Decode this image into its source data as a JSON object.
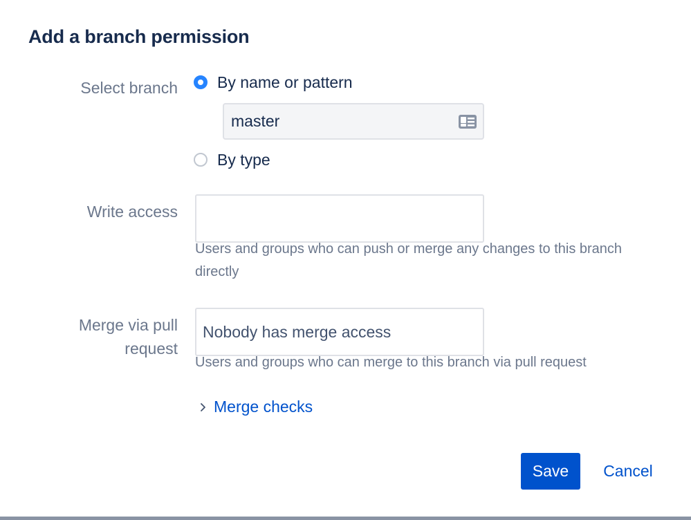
{
  "dialog": {
    "title": "Add a branch permission"
  },
  "select_branch": {
    "label": "Select branch",
    "option_pattern": "By name or pattern",
    "option_type": "By type",
    "selected": "By name or pattern",
    "pattern_value": "master"
  },
  "write_access": {
    "label": "Write access",
    "value": "",
    "help": "Users and groups who can push or merge any changes to this branch directly"
  },
  "merge_pr": {
    "label_line1": "Merge via pull",
    "label_line2": "request",
    "value": "Nobody has merge access",
    "help": "Users and groups who can merge to this branch via pull request"
  },
  "merge_checks": {
    "label": "Merge checks"
  },
  "footer": {
    "save_label": "Save",
    "cancel_label": "Cancel"
  },
  "colors": {
    "primary": "#0052cc",
    "radio_selected": "#2684ff",
    "title_text": "#172b4d",
    "label_text": "#6b778c"
  },
  "icons": {
    "pattern_field": "id-card-icon",
    "expander": "chevron-right-icon"
  }
}
